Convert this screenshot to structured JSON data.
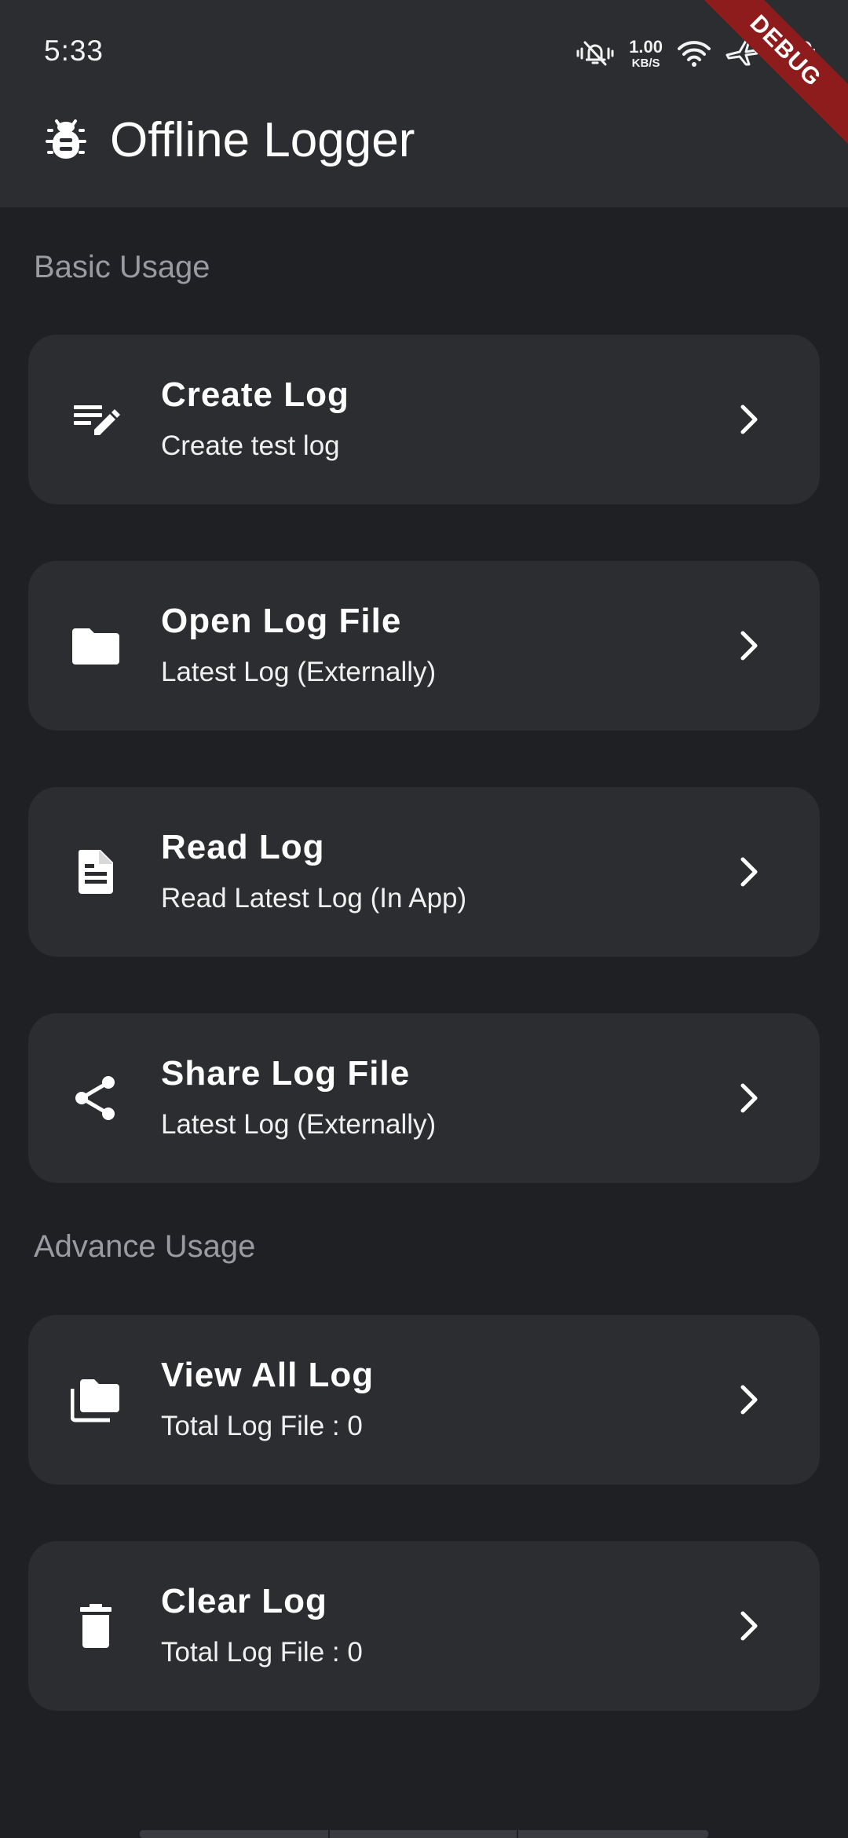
{
  "status_bar": {
    "time": "5:33",
    "net_speed_value": "1.00",
    "net_speed_unit": "KB/S",
    "icons": [
      "vibrate-mute-icon",
      "wifi-icon",
      "airplane-mode-icon",
      "battery-icon"
    ]
  },
  "debug_banner": "DEBUG",
  "app_bar": {
    "icon": "bug-icon",
    "title": "Offline Logger"
  },
  "sections": {
    "basic": {
      "label": "Basic Usage",
      "items": [
        {
          "icon": "edit-note-icon",
          "title": "Create Log",
          "subtitle": "Create test log"
        },
        {
          "icon": "folder-icon",
          "title": "Open Log File",
          "subtitle": "Latest Log (Externally)"
        },
        {
          "icon": "document-icon",
          "title": "Read Log",
          "subtitle": "Read Latest Log (In App)"
        },
        {
          "icon": "share-icon",
          "title": "Share Log File",
          "subtitle": "Latest Log (Externally)"
        }
      ]
    },
    "advance": {
      "label": "Advance Usage",
      "items": [
        {
          "icon": "folder-copy-icon",
          "title": "View All Log",
          "subtitle": "Total Log File : 0"
        },
        {
          "icon": "trash-icon",
          "title": "Clear Log",
          "subtitle": "Total Log File : 0"
        }
      ]
    }
  },
  "colors": {
    "background": "#1f2024",
    "surface": "#2c2d31",
    "section_label": "#9a9ba1",
    "debug_banner": "#8f1c1c"
  }
}
